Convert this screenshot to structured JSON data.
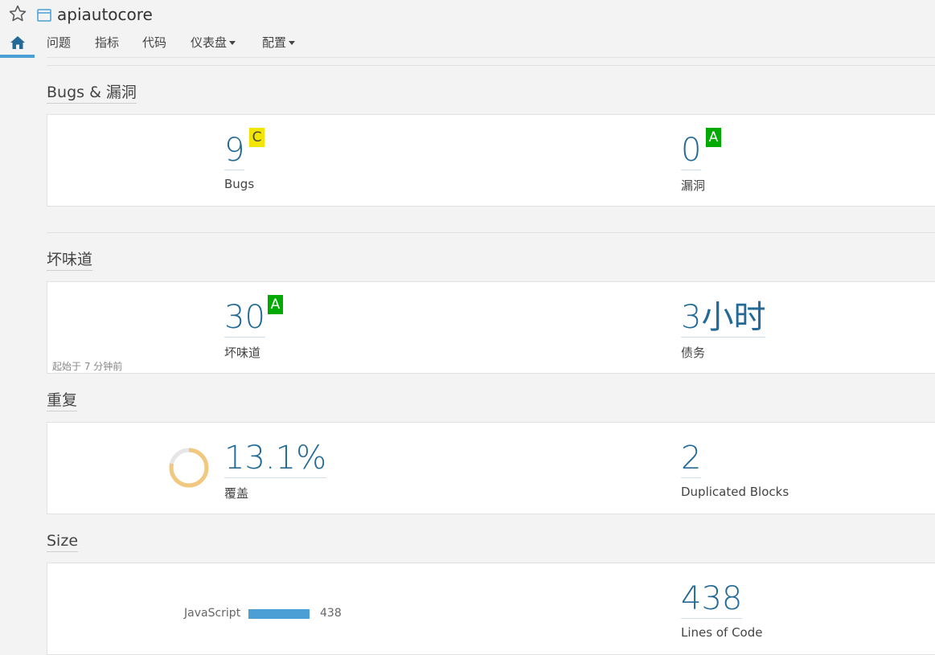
{
  "header": {
    "project_name": "apiautocore",
    "icons": {
      "star": "star-outline-icon",
      "project": "project-icon",
      "home": "home-icon"
    }
  },
  "nav": {
    "items": [
      {
        "label": "问题"
      },
      {
        "label": "指标"
      },
      {
        "label": "代码"
      },
      {
        "label": "仪表盘",
        "dropdown": true
      },
      {
        "label": "配置",
        "dropdown": true
      }
    ]
  },
  "sections": {
    "bugs": {
      "title": "Bugs & 漏洞",
      "bugs_value": "9",
      "bugs_rating": "C",
      "bugs_label": "Bugs",
      "vuln_value": "0",
      "vuln_rating": "A",
      "vuln_label": "漏洞"
    },
    "smells": {
      "title": "坏味道",
      "smells_value": "30",
      "smells_rating": "A",
      "smells_label": "坏味道",
      "debt_value": "3小时",
      "debt_label": "债务",
      "since": "起始于 7 分钟前"
    },
    "duplications": {
      "title": "重复",
      "coverage_value": "13.1%",
      "coverage_fraction": 0.131,
      "coverage_label": "覆盖",
      "blocks_value": "2",
      "blocks_label": "Duplicated Blocks"
    },
    "size": {
      "title": "Size",
      "language": "JavaScript",
      "language_value": "438",
      "loc_value": "438",
      "loc_label": "Lines of Code"
    }
  },
  "colors": {
    "accent": "#4b9fd5",
    "metric": "#236a97",
    "rating_a": "#00aa00",
    "rating_c": "#f2e600",
    "donut_track": "#e6e6e6",
    "donut_fill": "#f0c87f"
  }
}
